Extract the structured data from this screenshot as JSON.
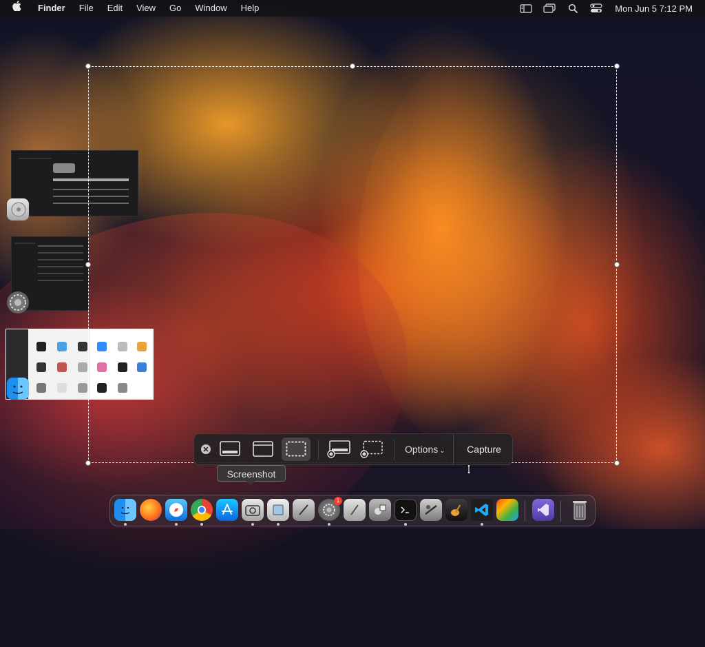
{
  "menubar": {
    "apple_icon": "apple-logo-icon",
    "items": [
      "Finder",
      "File",
      "Edit",
      "View",
      "Go",
      "Window",
      "Help"
    ],
    "status_icons": [
      "sidebar-icon",
      "window-stack-icon",
      "search-icon",
      "control-center-icon"
    ],
    "clock": "Mon Jun 5  7:12 PM"
  },
  "toolbar": {
    "options_label": "Options",
    "capture_label": "Capture",
    "tooltip": "Screenshot",
    "buttons": [
      "capture-entire-screen",
      "capture-selected-window",
      "capture-selected-portion",
      "record-entire-screen",
      "record-selected-portion"
    ],
    "active_button": "capture-selected-portion"
  },
  "stage_manager": {
    "groups": [
      "Disk Utility",
      "System Settings",
      "Finder"
    ]
  },
  "dock": {
    "apps": [
      "Finder",
      "Firefox",
      "Safari",
      "Google Chrome",
      "App Store",
      "Screenshot",
      "Preview",
      "Script Editor",
      "System Settings",
      "TextEdit",
      "Automator",
      "Terminal",
      "Directory Utility",
      "GarageBand",
      "Visual Studio Code",
      "Photo Booth",
      "Visual Studio",
      "Trash"
    ],
    "system_settings_badge": "1"
  },
  "colors": {
    "accent": "#0a84ff",
    "selection_border": "#ffffff",
    "toolbar_bg": "#262224"
  }
}
